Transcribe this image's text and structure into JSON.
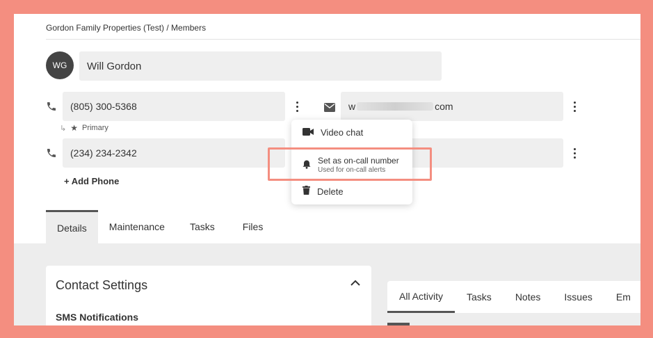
{
  "breadcrumb": "Gordon Family Properties (Test) / Members",
  "contact": {
    "initials": "WG",
    "name": "Will Gordon",
    "phones": [
      {
        "value": "(805) 300-5368",
        "tag": "Primary"
      },
      {
        "value": "(234) 234-2342"
      }
    ],
    "email_prefix": "w",
    "email_suffix": "com",
    "add_phone_label": "+ Add Phone"
  },
  "tabs": [
    "Details",
    "Maintenance",
    "Tasks",
    "Files"
  ],
  "menu": {
    "video_chat": "Video chat",
    "on_call_title": "Set as on-call number",
    "on_call_sub": "Used for on-call alerts",
    "delete": "Delete"
  },
  "contact_settings": {
    "title": "Contact Settings",
    "section": "SMS Notifications"
  },
  "activity_tabs": [
    "All Activity",
    "Tasks",
    "Notes",
    "Issues",
    "Em"
  ],
  "colors": {
    "background": "#f48e80",
    "highlight": "#f48e80",
    "avatar": "#444444"
  }
}
